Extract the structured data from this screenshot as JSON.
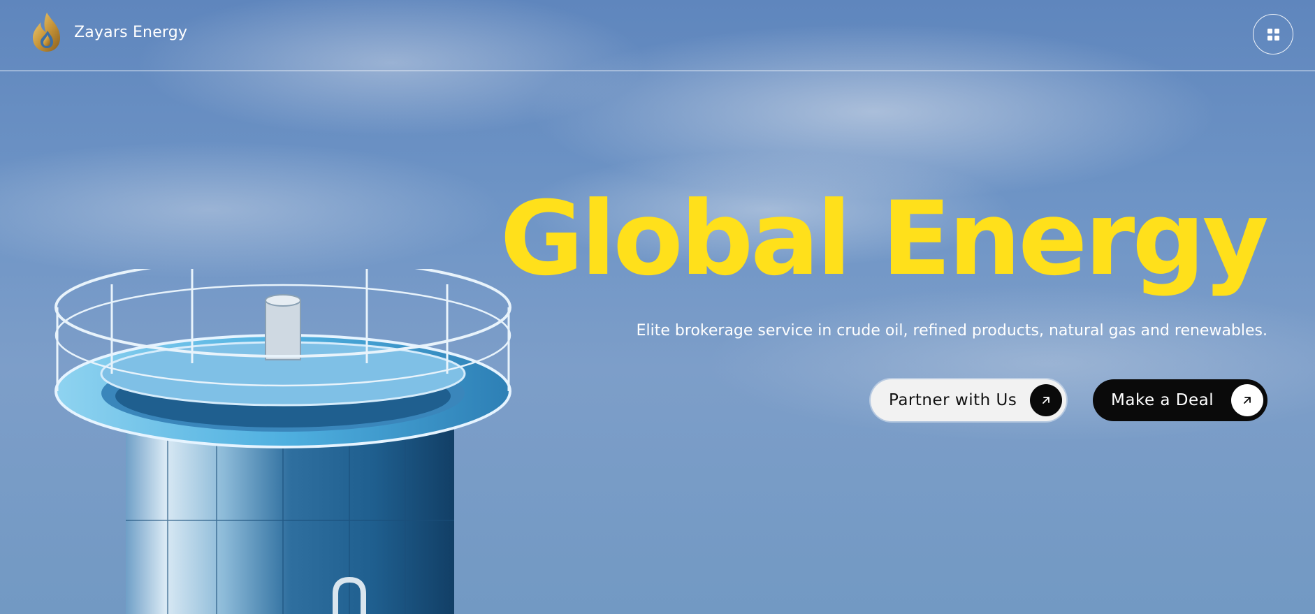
{
  "header": {
    "brand": "Zayars Energy",
    "logo_icon": "flame-logo-icon",
    "menu_icon": "grid-menu-icon"
  },
  "hero": {
    "headline": "Global Energy",
    "subtitle": "Elite brokerage service in crude oil, refined products, natural gas and renewables.",
    "headline_color": "#ffe01b",
    "buttons": [
      {
        "label": "Partner with Us",
        "icon": "arrow-up-right-icon"
      },
      {
        "label": "Make a Deal",
        "icon": "arrow-up-right-icon"
      }
    ]
  }
}
